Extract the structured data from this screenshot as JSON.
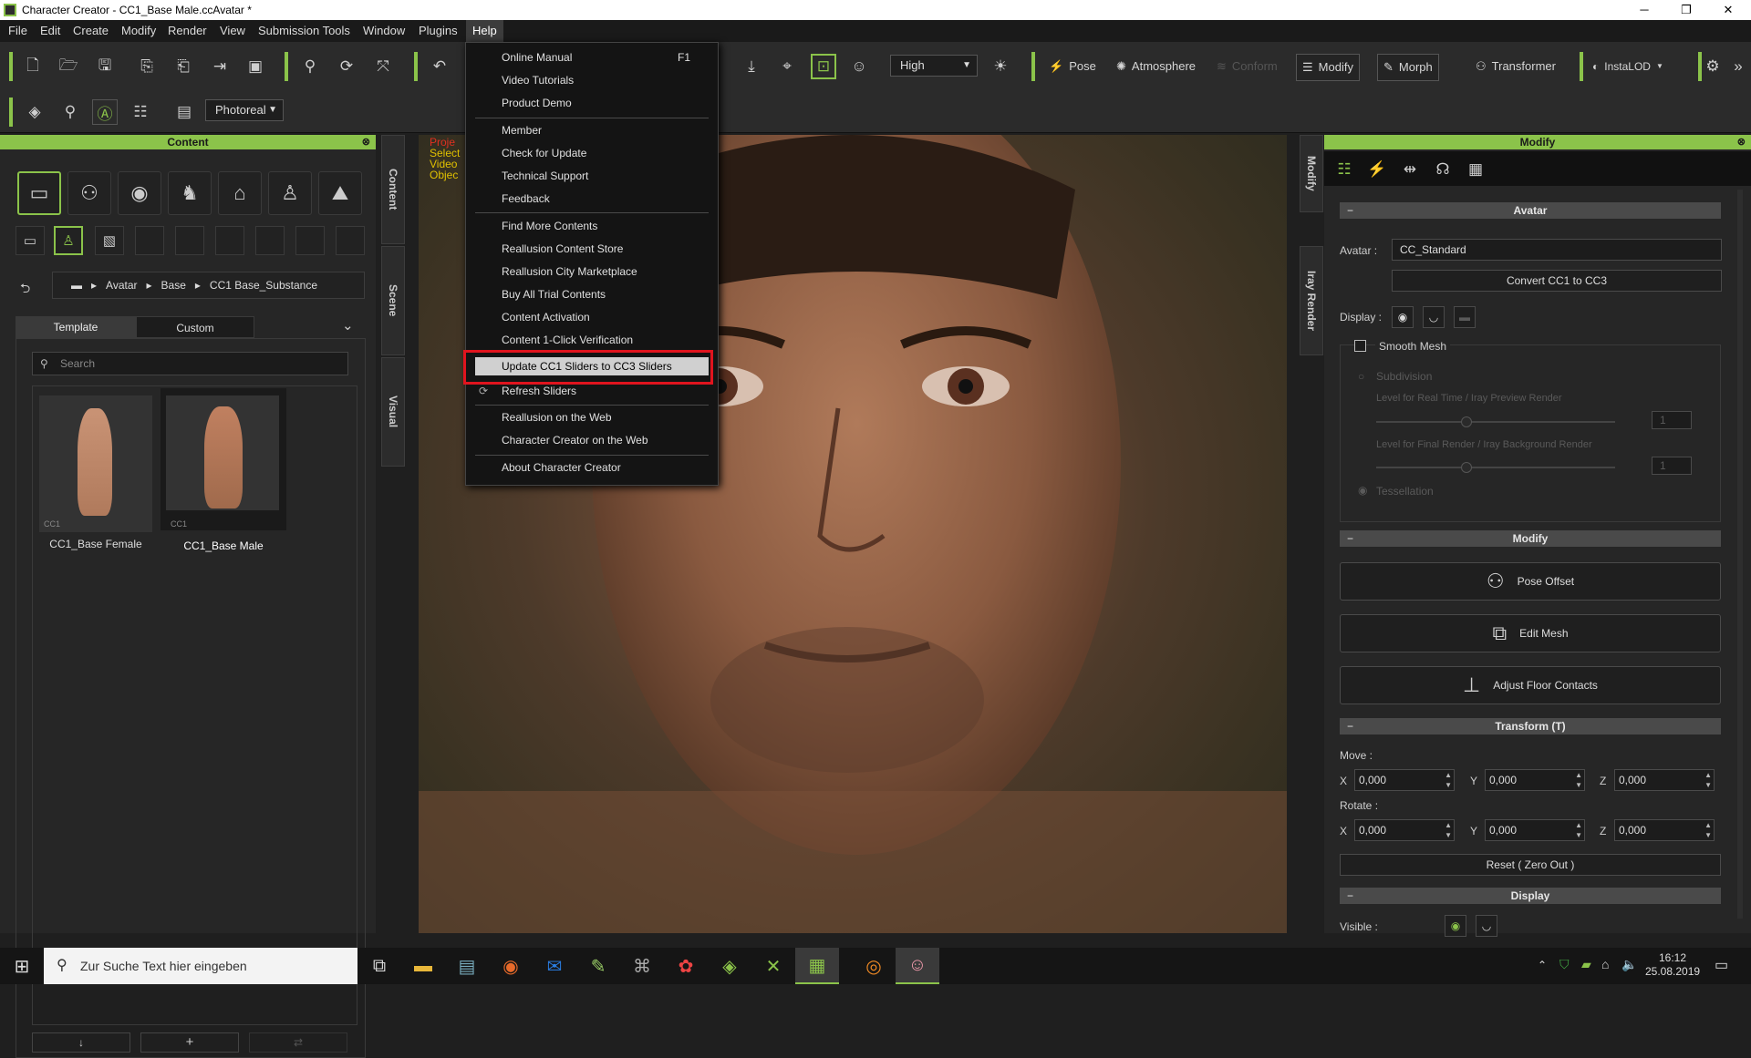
{
  "title_bar": {
    "title": "Character Creator - CC1_Base Male.ccAvatar *",
    "minimize": "─",
    "maximize": "❐",
    "close": "✕"
  },
  "menu": [
    "File",
    "Edit",
    "Create",
    "Modify",
    "Render",
    "View",
    "Submission Tools",
    "Window",
    "Plugins",
    "Help"
  ],
  "toolbar": {
    "quality": "High",
    "pose": "Pose",
    "atmosphere": "Atmosphere",
    "conform": "Conform",
    "modify": "Modify",
    "morph": "Morph",
    "transformer": "Transformer",
    "instalod": "InstaLOD",
    "render_mode": "Photoreal"
  },
  "help_menu": {
    "items": [
      {
        "label": "Online Manual",
        "shortcut": "F1"
      },
      {
        "label": "Video Tutorials"
      },
      {
        "label": "Product Demo"
      },
      {
        "label": "Member"
      },
      {
        "label": "Check for Update"
      },
      {
        "label": "Technical Support"
      },
      {
        "label": "Feedback"
      },
      {
        "label": "Find More Contents"
      },
      {
        "label": "Reallusion Content Store"
      },
      {
        "label": "Reallusion City Marketplace"
      },
      {
        "label": "Buy All Trial Contents"
      },
      {
        "label": "Content Activation"
      },
      {
        "label": "Content 1-Click Verification"
      },
      {
        "label": "Update CC1 Sliders to CC3 Sliders"
      },
      {
        "label": "Refresh Sliders"
      },
      {
        "label": "Reallusion on the Web"
      },
      {
        "label": "Character Creator on the Web"
      },
      {
        "label": "About Character Creator"
      }
    ]
  },
  "content_panel": {
    "title": "Content",
    "breadcrumb": [
      "Avatar",
      "Base",
      "CC1 Base_Substance"
    ],
    "tabs": [
      "Template",
      "Custom"
    ],
    "search_placeholder": "Search",
    "items": [
      {
        "name": "CC1_Base Female",
        "tag": "CC1"
      },
      {
        "name": "CC1_Base Male",
        "tag": "CC1"
      }
    ],
    "side_tabs": [
      "Content",
      "Scene",
      "Visual"
    ]
  },
  "viewport": {
    "overlay_lines": [
      "Proje",
      "Select",
      "Video",
      "Objec"
    ]
  },
  "right_side_tabs": [
    "Modify",
    "Iray Render"
  ],
  "modify_panel": {
    "title": "Modify",
    "avatar_section": "Avatar",
    "avatar_label": "Avatar :",
    "avatar_value": "CC_Standard",
    "convert_button": "Convert CC1 to CC3",
    "display_label": "Display :",
    "smooth_mesh": "Smooth Mesh",
    "subdivision": "Subdivision",
    "level_realtime": "Level for Real Time / Iray Preview Render",
    "level_final": "Level for Final Render / Iray Background Render",
    "level_value": "1",
    "tessellation": "Tessellation",
    "modify_section": "Modify",
    "pose_offset": "Pose Offset",
    "edit_mesh": "Edit Mesh",
    "adjust_floor": "Adjust Floor Contacts",
    "transform_section": "Transform  (T)",
    "move_label": "Move :",
    "rotate_label": "Rotate :",
    "axes": [
      "X",
      "Y",
      "Z"
    ],
    "move": [
      "0,000",
      "0,000",
      "0,000"
    ],
    "rotate": [
      "0,000",
      "0,000",
      "0,000"
    ],
    "reset": "Reset ( Zero Out )",
    "display_section": "Display",
    "visible_label": "Visible :"
  },
  "taskbar": {
    "search_placeholder": "Zur Suche Text hier eingeben",
    "time": "16:12",
    "date": "25.08.2019"
  }
}
